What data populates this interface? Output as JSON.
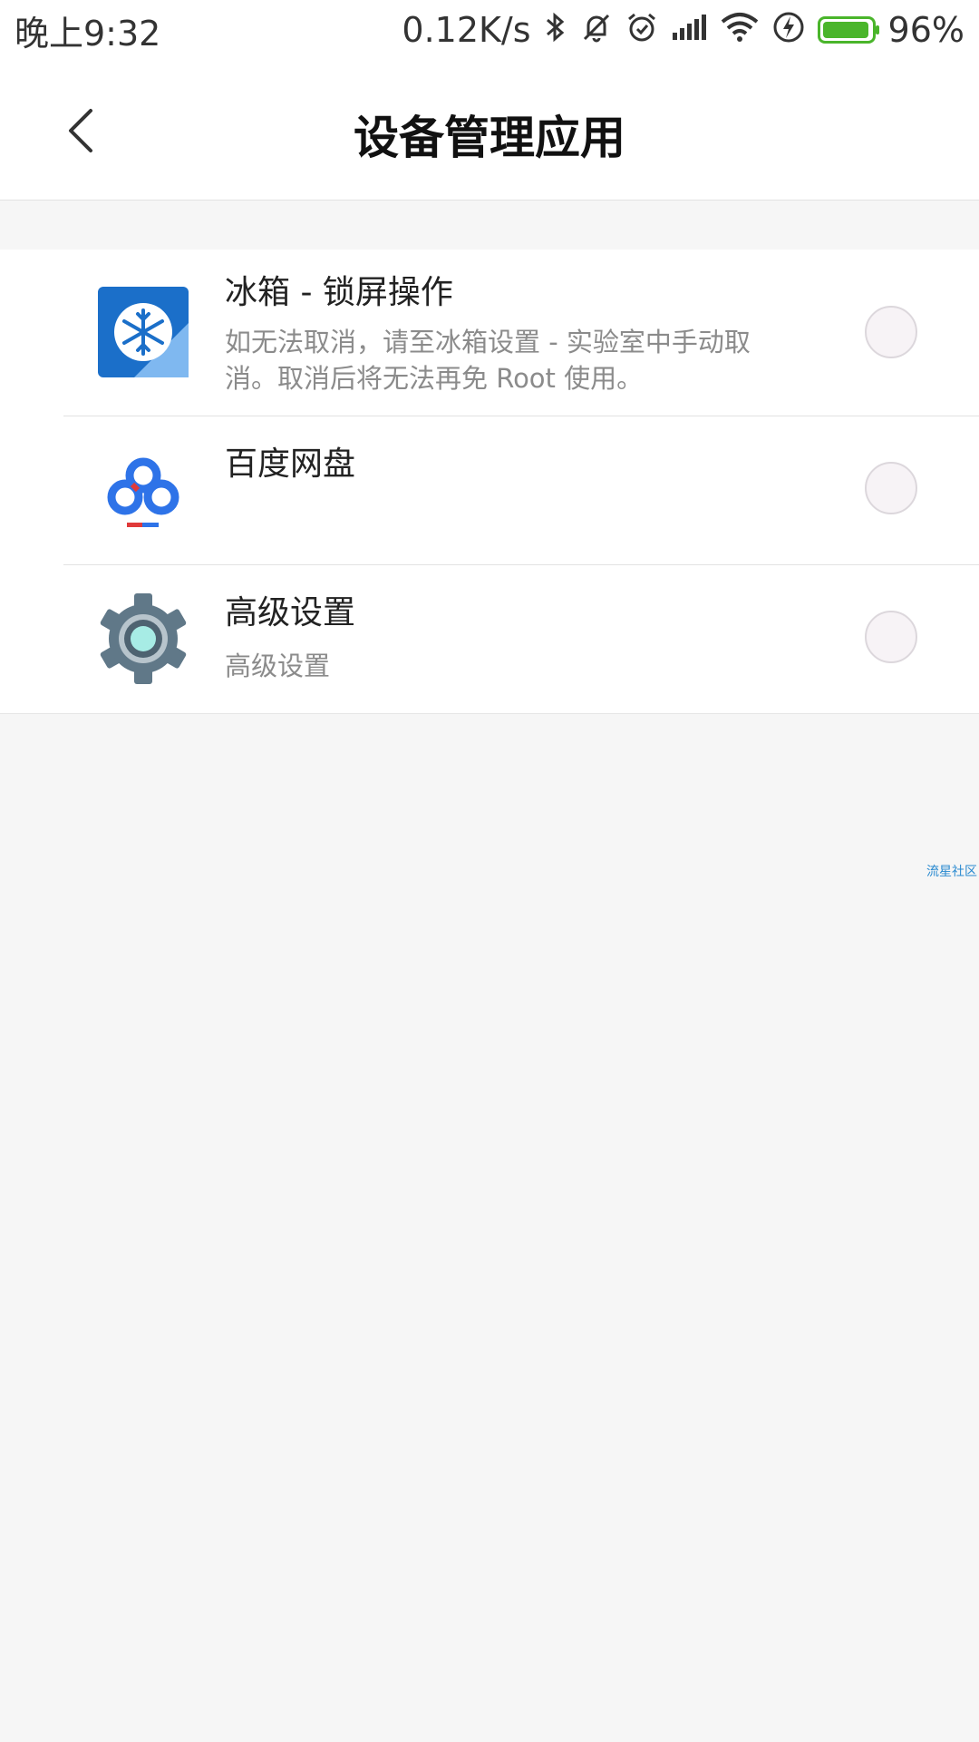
{
  "status_bar": {
    "time": "晚上9:32",
    "speed": "0.12K/s",
    "battery_percent_label": "96%",
    "battery_level": 0.96,
    "icons": [
      "bluetooth-icon",
      "mute-bell-icon",
      "alarm-icon",
      "signal-icon",
      "wifi-icon",
      "charging-icon",
      "battery-icon"
    ]
  },
  "appbar": {
    "title": "设备管理应用",
    "back_icon": "chevron-left-icon"
  },
  "items": [
    {
      "name": "冰箱 - 锁屏操作",
      "desc": "如无法取消，请至冰箱设置 - 实验室中手动取消。取消后将无法再免 Root 使用。",
      "icon": "snowflake-icon",
      "checked": false
    },
    {
      "name": "百度网盘",
      "desc": "",
      "icon": "baidu-cloud-icon",
      "checked": false
    },
    {
      "name": "高级设置",
      "desc": "高级设置",
      "icon": "gear-icon",
      "checked": false
    }
  ],
  "watermark": "流星社区",
  "colors": {
    "battery": "#4ab52b",
    "freezer_blue": "#1b6fc9",
    "baidu_blue": "#2e73e8",
    "gear_gray": "#607888",
    "gear_teal": "#a7ece5"
  }
}
